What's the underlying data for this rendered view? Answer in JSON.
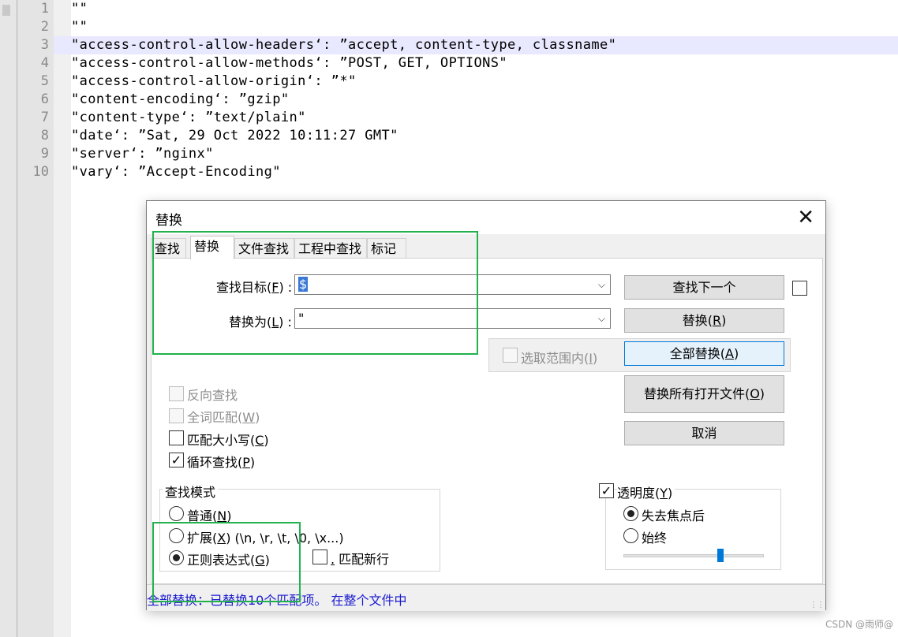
{
  "editor": {
    "lines": [
      {
        "num": "1",
        "text": "\"\""
      },
      {
        "num": "2",
        "text": "\"\""
      },
      {
        "num": "3",
        "text": "\"access-control-allow-headers‘: ”accept, content-type, classname\""
      },
      {
        "num": "4",
        "text": "\"access-control-allow-methods‘: ”POST, GET, OPTIONS\""
      },
      {
        "num": "5",
        "text": "\"access-control-allow-origin‘: ”*\""
      },
      {
        "num": "6",
        "text": "\"content-encoding‘: ”gzip\""
      },
      {
        "num": "7",
        "text": "\"content-type‘: ”text/plain\""
      },
      {
        "num": "8",
        "text": "\"date‘: ”Sat, 29 Oct 2022 10:11:27 GMT\""
      },
      {
        "num": "9",
        "text": "\"server‘: ”nginx\""
      },
      {
        "num": "10",
        "text": "\"vary‘: ”Accept-Encoding\""
      }
    ],
    "current_line": "3"
  },
  "dialog": {
    "title": "替换",
    "close": "✕",
    "tabs": [
      "查找",
      "替换",
      "文件查找",
      "工程中查找",
      "标记"
    ],
    "active_tab": "替换",
    "find_label_pre": "查找目标(",
    "find_label_key": "F",
    "find_label_post": ") :",
    "find_value": "$",
    "replace_label_pre": "替换为(",
    "replace_label_key": "L",
    "replace_label_post": ") :",
    "replace_value": "\"",
    "in_selection_pre": "选取范围内(",
    "in_selection_key": "I",
    "in_selection_post": ")",
    "buttons": {
      "find_next": "查找下一个",
      "replace_pre": "替换(",
      "replace_key": "R",
      "replace_post": ")",
      "replace_all_pre": "全部替换(",
      "replace_all_key": "A",
      "replace_all_post": ")",
      "replace_all_open_pre": "替换所有打开文件(",
      "replace_all_open_key": "O",
      "replace_all_open_post": ")",
      "cancel": "取消"
    },
    "options": {
      "backward": "反向查找",
      "whole_word_pre": "全词匹配(",
      "whole_word_key": "W",
      "whole_word_post": ")",
      "match_case_pre": "匹配大小写(",
      "match_case_key": "C",
      "match_case_post": ")",
      "wrap_pre": "循环查找(",
      "wrap_key": "P",
      "wrap_post": ")",
      "wrap_checked": true
    },
    "mode": {
      "title": "查找模式",
      "normal_pre": "普通(",
      "normal_key": "N",
      "normal_post": ")",
      "extended_pre": "扩展(",
      "extended_key": "X",
      "extended_post": ") (\\n, \\r, \\t, \\0, \\x...)",
      "regex_pre": "正则表达式(",
      "regex_key": "G",
      "regex_post": ")",
      "dot_newline_key": ".",
      "dot_newline_post": " 匹配新行",
      "selected": "regex"
    },
    "transparency": {
      "label_pre": "透明度(",
      "label_key": "Y",
      "label_post": ")",
      "checked": true,
      "on_lose_focus": "失去焦点后",
      "always": "始终",
      "selected": "on_lose_focus",
      "level": 0.7
    },
    "status": "全部替换：已替换10个匹配项。 在整个文件中"
  },
  "watermark": "CSDN @雨师@",
  "colors": {
    "highlight_box": "#22b14c",
    "status_text": "#1a1ad0",
    "current_line": "#e8e8ff"
  }
}
